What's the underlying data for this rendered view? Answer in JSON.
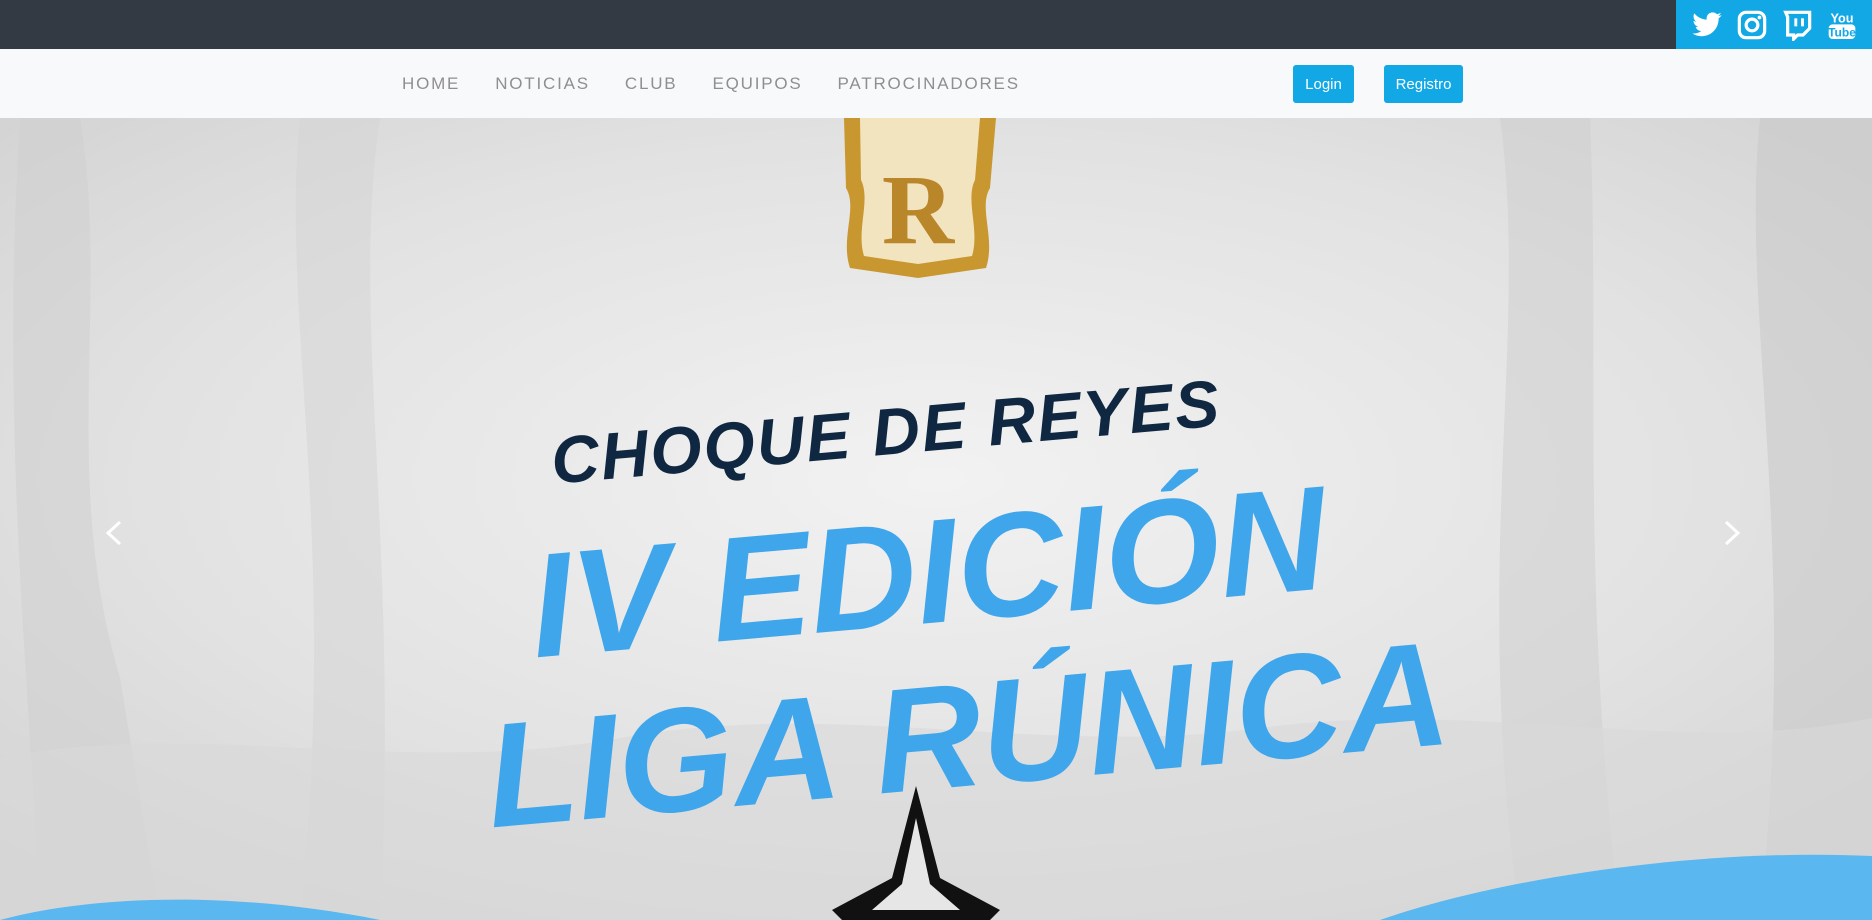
{
  "social": {
    "items": [
      {
        "name": "twitter",
        "icon": "twitter-icon"
      },
      {
        "name": "instagram",
        "icon": "instagram-icon"
      },
      {
        "name": "twitch",
        "icon": "twitch-icon"
      },
      {
        "name": "youtube",
        "icon": "youtube-icon",
        "label_line1": "You",
        "label_line2": "Tube"
      }
    ]
  },
  "nav": {
    "items": [
      "HOME",
      "NOTICIAS",
      "CLUB",
      "EQUIPOS",
      "PATROCINADORES"
    ],
    "login_label": "Login",
    "register_label": "Registro"
  },
  "hero": {
    "subtitle": "CHOQUE DE REYES",
    "title_line1": "IV EDICIÓN",
    "title_line2": "LIGA RÚNICA",
    "logo_letter": "R"
  },
  "colors": {
    "topbar": "#343a43",
    "accent": "#12a8e6",
    "navbar": "#f8f9fa",
    "nav_text": "#8f8f8f",
    "hero_blue": "#3fa6eb",
    "hero_dark": "#0f2740",
    "gold": "#c9972f"
  }
}
